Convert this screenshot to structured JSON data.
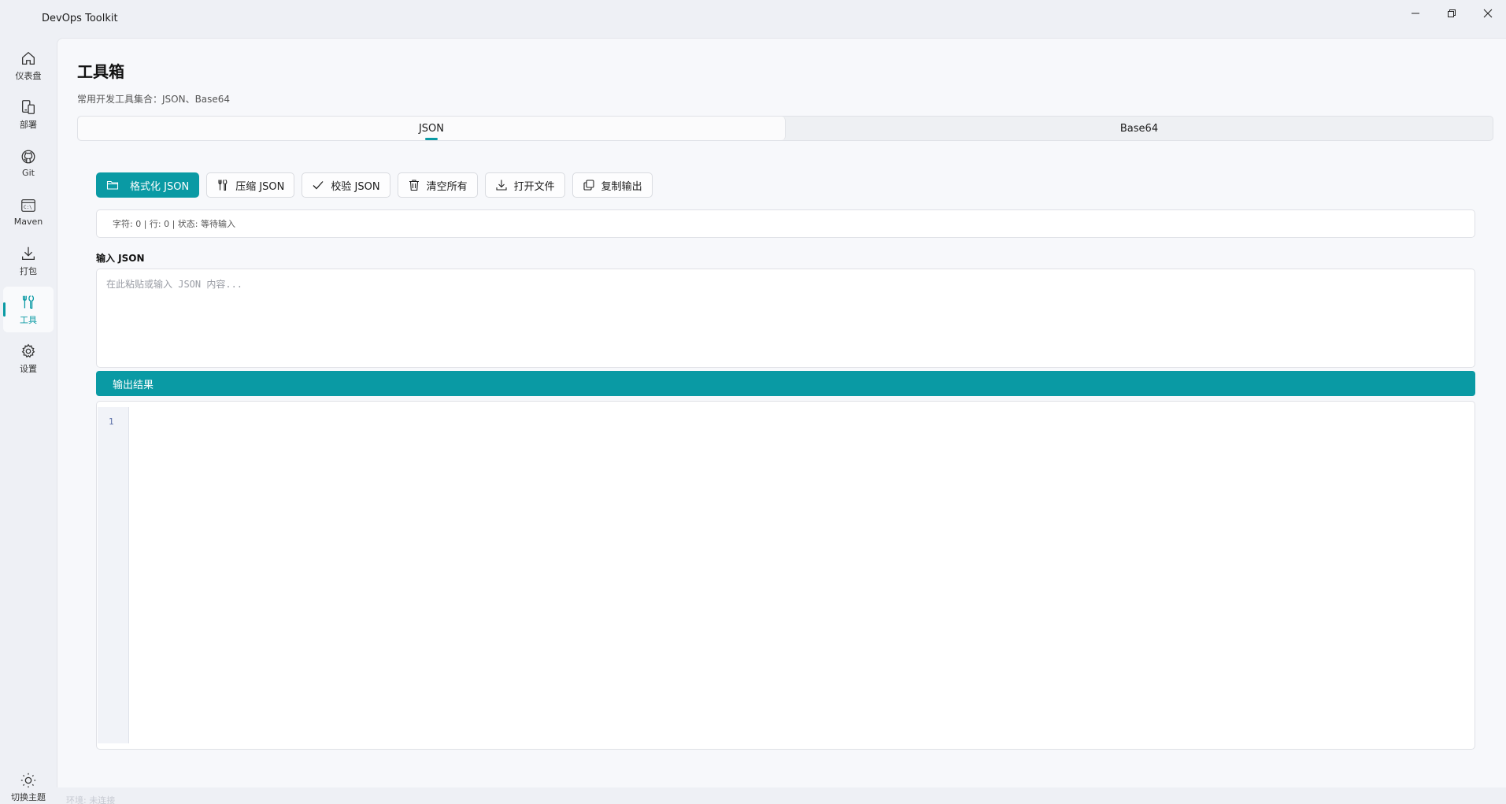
{
  "window": {
    "title": "DevOps Toolkit"
  },
  "sidebar": {
    "items": [
      {
        "label": "仪表盘",
        "icon": "home-icon"
      },
      {
        "label": "部署",
        "icon": "deploy-icon"
      },
      {
        "label": "Git",
        "icon": "github-icon"
      },
      {
        "label": "Maven",
        "icon": "terminal-icon"
      },
      {
        "label": "打包",
        "icon": "download-icon"
      },
      {
        "label": "工具",
        "icon": "tools-icon",
        "active": true
      },
      {
        "label": "设置",
        "icon": "gear-icon"
      }
    ],
    "theme_toggle_label": "切换主题",
    "footer_faint_text": "环境: 未连接"
  },
  "page": {
    "title": "工具箱",
    "subtitle": "常用开发工具集合：JSON、Base64"
  },
  "tabs": [
    {
      "label": "JSON",
      "active": true
    },
    {
      "label": "Base64",
      "active": false
    }
  ],
  "toolbar": {
    "format": "格式化 JSON",
    "compress": "压缩 JSON",
    "validate": "校验 JSON",
    "clear": "清空所有",
    "open_file": "打开文件",
    "copy_output": "复制输出"
  },
  "status": {
    "text": "字符: 0 | 行: 0 | 状态: 等待输入"
  },
  "input": {
    "label": "输入 JSON",
    "placeholder": "在此粘贴或输入 JSON 内容...",
    "value": ""
  },
  "output": {
    "header": "输出结果",
    "line_numbers": [
      "1"
    ]
  },
  "colors": {
    "accent": "#0a9aa4",
    "background": "#eef0f5",
    "panel": "#f7f8fb"
  }
}
